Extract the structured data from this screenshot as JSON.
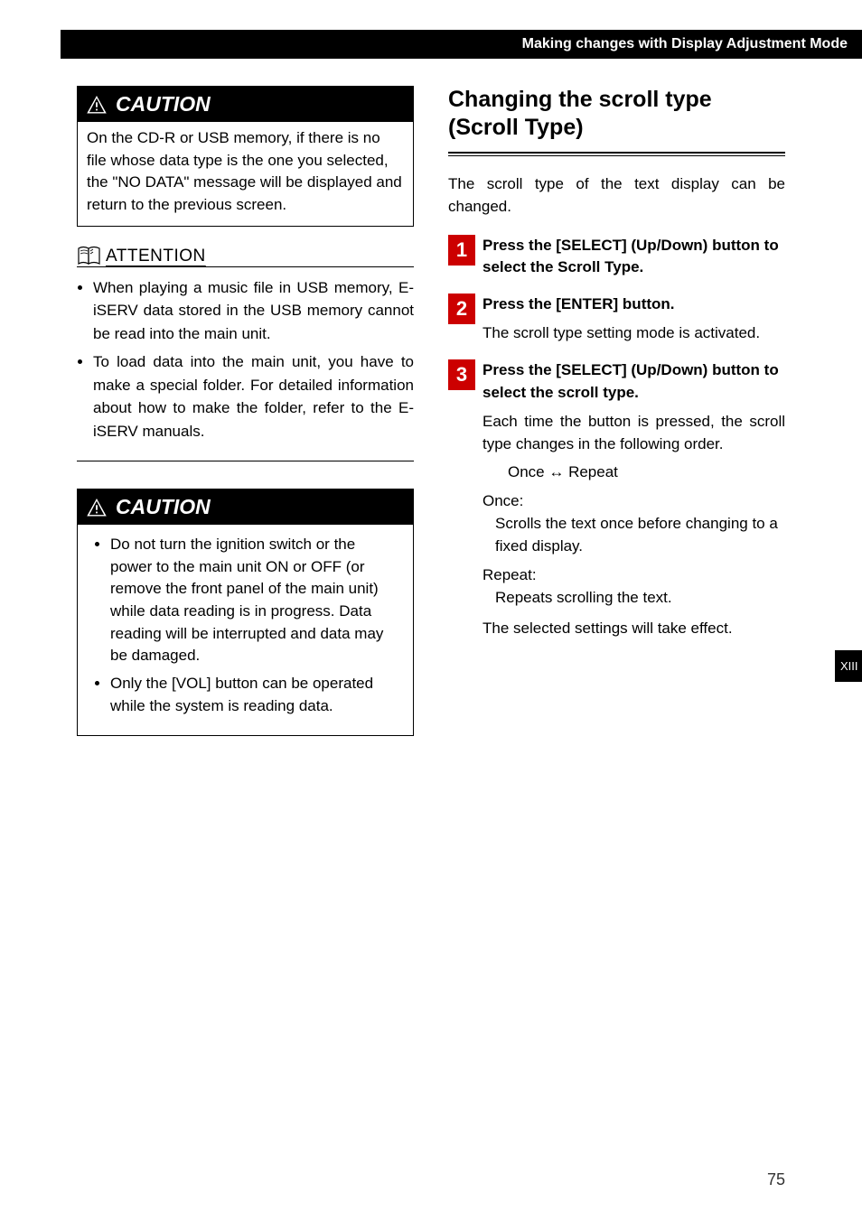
{
  "header": "Making changes with Display Adjustment Mode",
  "leftCol": {
    "caution1": {
      "label": "CAUTION",
      "text": "On the CD-R or USB memory, if there is no file whose data type is the one you selected, the \"NO DATA\" message will be displayed and return to the previous screen."
    },
    "attention": {
      "label": "ATTENTION",
      "items": [
        "When playing a music file in USB memory, E-iSERV data stored in the USB memory cannot be read into the main unit.",
        "To load data into the main unit, you have to make a special folder. For detailed information about how to make the folder, refer to the E-iSERV manuals."
      ]
    },
    "caution2": {
      "label": "CAUTION",
      "items": [
        "Do not turn the ignition switch or the power to the main unit ON or OFF (or remove the front panel of the main unit) while data reading is in progress. Data reading will be interrupted and data may be damaged.",
        "Only the [VOL] button can be operated while the system is reading data."
      ]
    }
  },
  "rightCol": {
    "title": "Changing the scroll type (Scroll Type)",
    "intro": "The scroll type of the text display can be changed.",
    "steps": [
      {
        "num": "1",
        "title": "Press the [SELECT] (Up/Down) button to select the Scroll Type."
      },
      {
        "num": "2",
        "title": "Press the [ENTER] button.",
        "desc": "The scroll type setting mode is activated."
      },
      {
        "num": "3",
        "title": "Press the [SELECT] (Up/Down) button to select the scroll type.",
        "desc": "Each time the button is pressed, the scroll type changes in the following order.",
        "options": "Once ↔ Repeat",
        "opt1label": "Once:",
        "opt1desc": "Scrolls the text once before changing to a fixed display.",
        "opt2label": "Repeat:",
        "opt2desc": "Repeats scrolling the text.",
        "final": "The selected settings will take effect."
      }
    ]
  },
  "sideTab": "XIII",
  "pageNum": "75"
}
